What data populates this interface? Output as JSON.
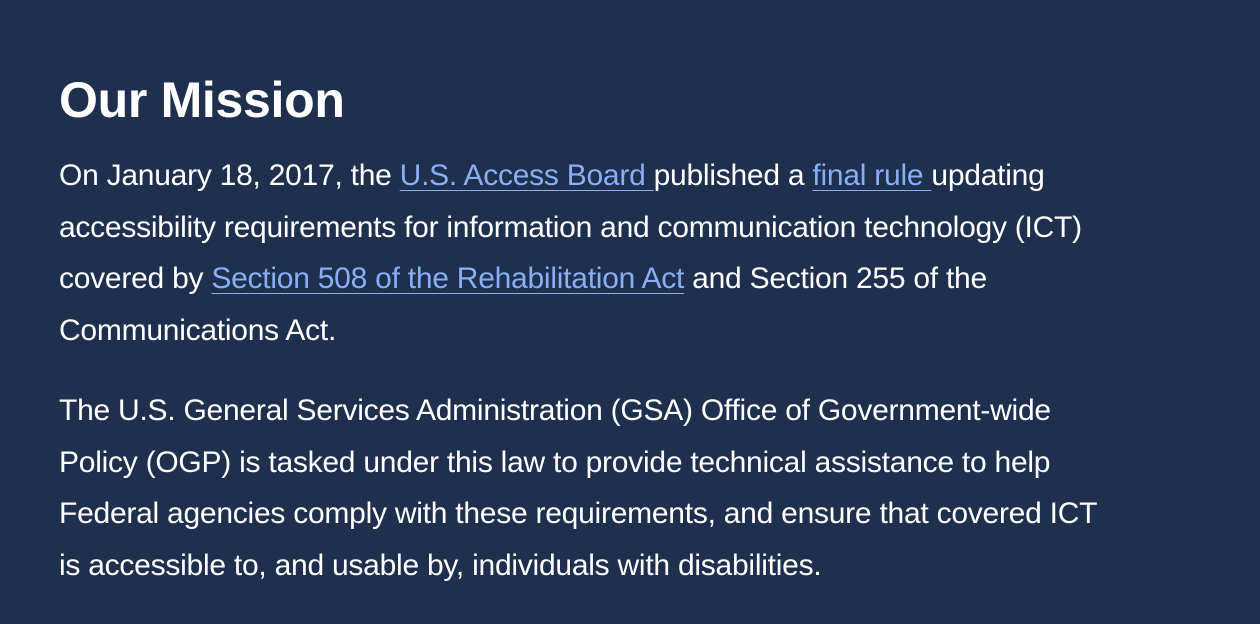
{
  "section": {
    "title": "Our Mission"
  },
  "paragraph_1": {
    "line_1_before": "On January 18, 2017, the ",
    "link_access_board": "U.S. Access Board ",
    "line_1_middle": "published a ",
    "link_final_rule": "final rule ",
    "line_1_after": "updating",
    "line_2": "accessibility requirements for information and communication technology (ICT)",
    "line_3_before": "covered by ",
    "link_section_508": "Section 508 of the Rehabilitation Act",
    "line_3_after": " and Section 255 of the",
    "line_4": "Communications Act."
  },
  "paragraph_2": {
    "line_1": "The U.S. General Services Administration (GSA) Office of Government-wide",
    "line_2": "Policy (OGP) is tasked under this law to provide technical assistance to help",
    "line_3": "Federal agencies comply with these requirements, and ensure that covered ICT",
    "line_4": "is accessible to, and usable by, individuals with disabilities."
  },
  "colors": {
    "background": "#1f2f4e",
    "text": "#ffffff",
    "link": "#88aef4"
  }
}
